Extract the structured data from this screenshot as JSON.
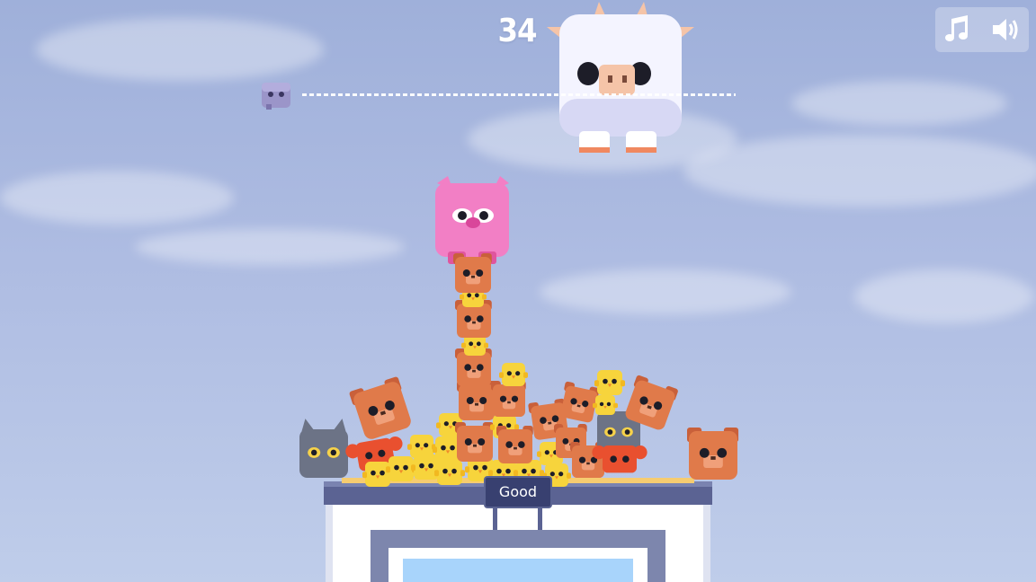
{
  "hud": {
    "score": "34",
    "music_icon": "music-note-icon",
    "sound_icon": "speaker-icon"
  },
  "feedback": {
    "label": "Good"
  },
  "colors": {
    "sky": "#a9b8e0",
    "cow": "#f4f4ff",
    "pig": "#f27fc5",
    "bear": "#e07a4a",
    "chick": "#f7d43c",
    "cat": "#6c7386",
    "crab": "#e9502f",
    "platform": "#5b6393",
    "building": "#ffffff",
    "window": "#a8d4fb"
  }
}
